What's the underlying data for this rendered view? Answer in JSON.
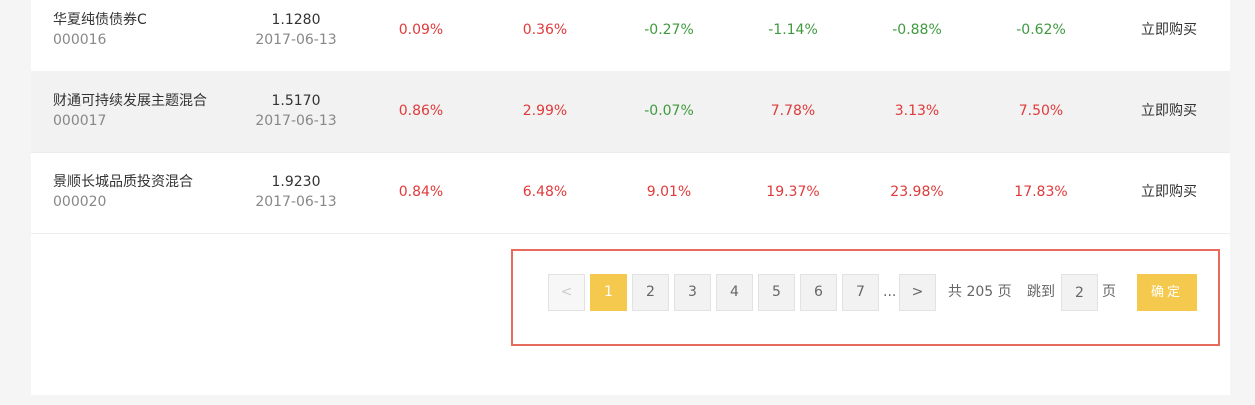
{
  "funds": [
    {
      "name": "华夏纯债债券C",
      "code": "000016",
      "nav": "1.1280",
      "date": "2017-06-13",
      "returns": [
        "0.09%",
        "0.36%",
        "-0.27%",
        "-1.14%",
        "-0.88%",
        "-0.62%"
      ],
      "buy_label": "立即购买"
    },
    {
      "name": "财通可持续发展主题混合",
      "code": "000017",
      "nav": "1.5170",
      "date": "2017-06-13",
      "returns": [
        "0.86%",
        "2.99%",
        "-0.07%",
        "7.78%",
        "3.13%",
        "7.50%"
      ],
      "buy_label": "立即购买"
    },
    {
      "name": "景顺长城品质投资混合",
      "code": "000020",
      "nav": "1.9230",
      "date": "2017-06-13",
      "returns": [
        "0.84%",
        "6.48%",
        "9.01%",
        "19.37%",
        "23.98%",
        "17.83%"
      ],
      "buy_label": "立即购买"
    }
  ],
  "colors": {
    "positive": "#e03a3a",
    "negative": "#3f9a3f",
    "accent": "#f5c94d",
    "highlight_border": "#e86a5d"
  },
  "pagination": {
    "prev_label": "<",
    "pages": [
      "1",
      "2",
      "3",
      "4",
      "5",
      "6",
      "7"
    ],
    "current_page": "1",
    "ellipsis": "...",
    "next_label": ">",
    "total_prefix": "共",
    "total_pages": "205",
    "total_suffix": "页",
    "jump_label": "跳到",
    "jump_value": "2",
    "jump_suffix": "页",
    "confirm_label": "确定"
  }
}
